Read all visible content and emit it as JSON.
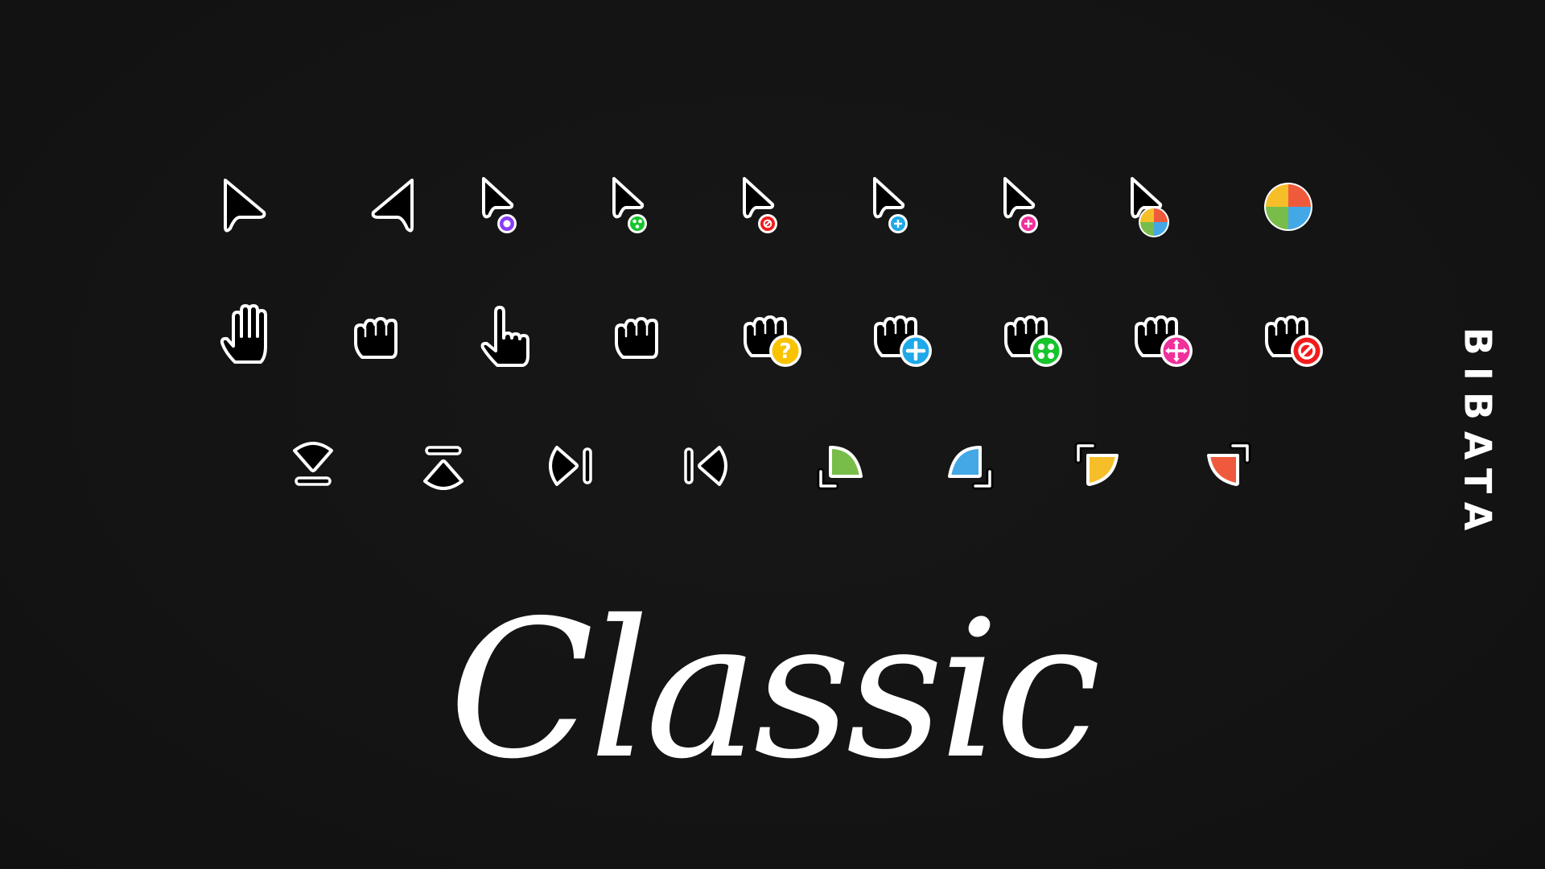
{
  "title": "Classic",
  "brand": "BIBATA",
  "colors": {
    "background": "#141414",
    "foreground": "#ffffff",
    "cursor_fill": "#000000",
    "purple": "#8a3cf2",
    "green": "#16c42c",
    "red": "#f21b1b",
    "blue": "#1fa9e9",
    "pink": "#f0309b",
    "yellow": "#f9c300",
    "pie_red": "#ef5a3c",
    "pie_blue": "#44a8e6",
    "pie_green": "#78bd4a",
    "pie_yellow": "#f6bf2a"
  },
  "cursor_rows": [
    [
      "left-pointer-icon",
      "right-pointer-icon",
      "pointer-context-menu-icon",
      "pointer-copy-icon",
      "pointer-no-drop-icon",
      "pointer-alias-icon",
      "pointer-move-icon",
      "pointer-wait-icon",
      "wait-spinner-icon"
    ],
    [
      "open-hand-icon",
      "grab-fist-icon",
      "pointing-hand-icon",
      "grabbing-fist-icon",
      "fist-help-icon",
      "fist-plus-icon",
      "fist-copy-icon",
      "fist-move-icon",
      "fist-not-allowed-icon"
    ],
    [
      "resize-bottom-edge-icon",
      "resize-top-edge-icon",
      "resize-right-edge-icon",
      "resize-left-edge-icon",
      "resize-bottom-left-corner-icon",
      "resize-bottom-right-corner-icon",
      "resize-top-left-corner-icon",
      "resize-top-right-corner-icon"
    ]
  ]
}
